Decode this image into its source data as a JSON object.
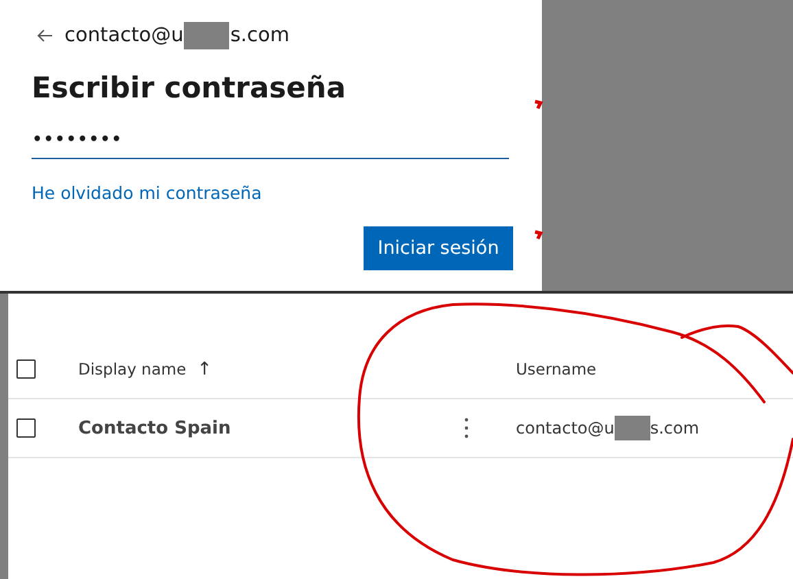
{
  "login": {
    "back_email": {
      "before": "contacto@u",
      "after": "s.com"
    },
    "title": "Escribir contraseña",
    "password": "••••••••",
    "forgot_link": "He olvidado mi contraseña",
    "button": "Iniciar sesión"
  },
  "table": {
    "select_all": {
      "checked": false
    },
    "columns": [
      {
        "label": "Display name",
        "sort_icon": "↑"
      },
      {
        "label": "Username"
      }
    ],
    "rows": [
      {
        "checked": false,
        "display_name": "Contacto Spain",
        "username": {
          "before": "contacto@u",
          "after": "s.com"
        }
      }
    ]
  }
}
